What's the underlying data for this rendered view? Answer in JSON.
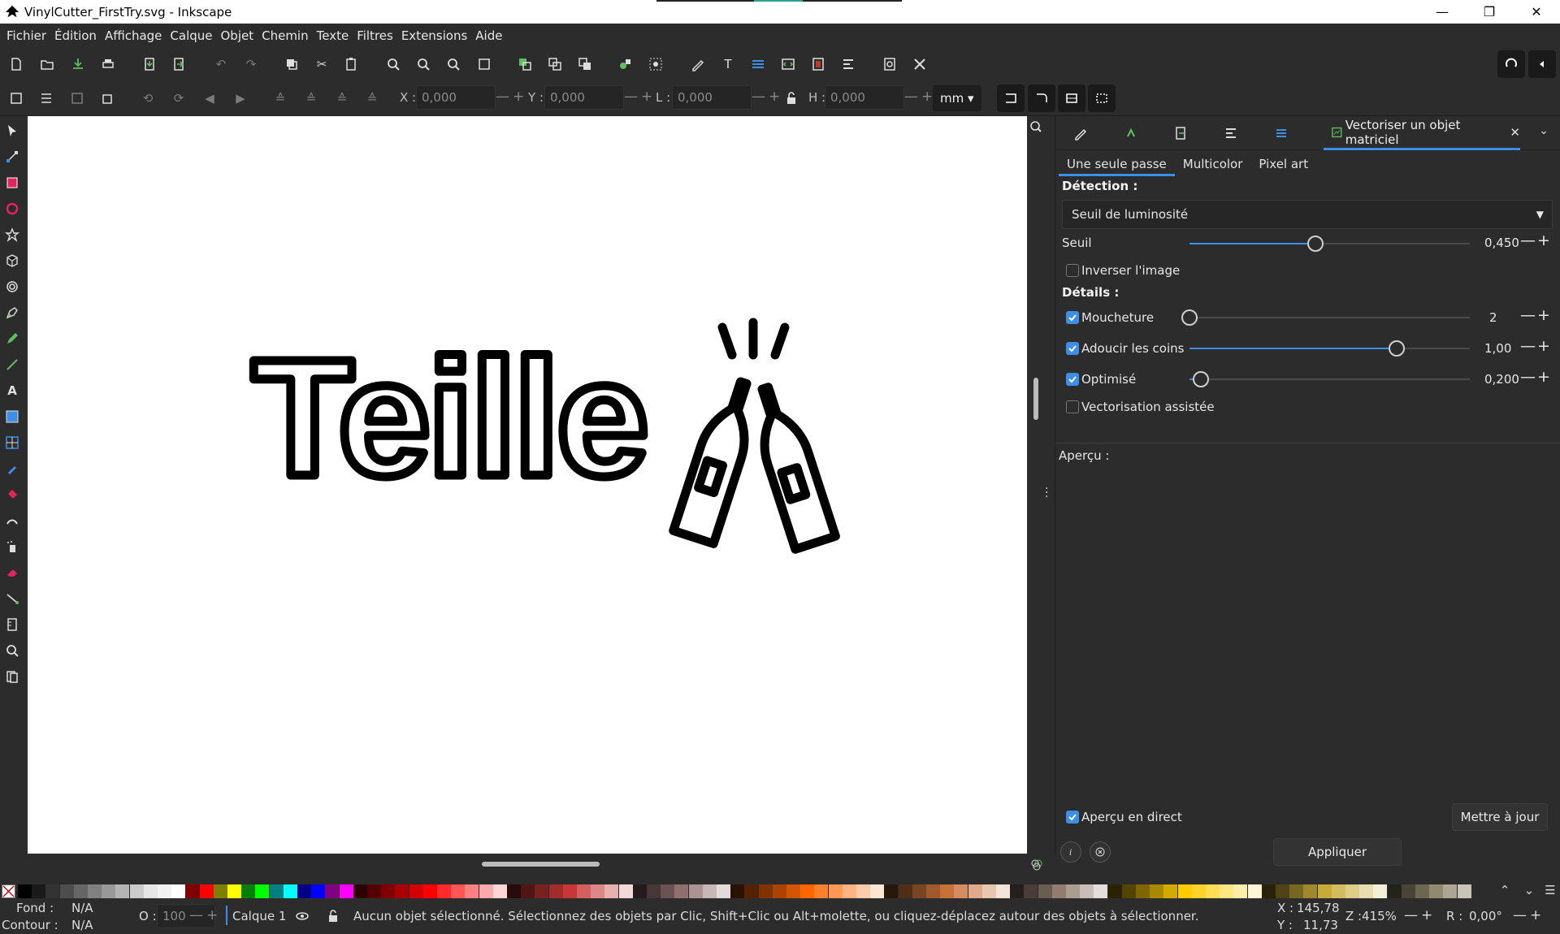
{
  "window": {
    "title": "VinylCutter_FirstTry.svg - Inkscape"
  },
  "menu": [
    "Fichier",
    "Édition",
    "Affichage",
    "Calque",
    "Objet",
    "Chemin",
    "Texte",
    "Filtres",
    "Extensions",
    "Aide"
  ],
  "toolctrl": {
    "x_label": "X :",
    "x_value": "0,000",
    "y_label": "Y :",
    "y_value": "0,000",
    "w_label": "L :",
    "w_value": "0,000",
    "h_label": "H :",
    "h_value": "0,000",
    "unit": "mm"
  },
  "canvas": {
    "text": "Teille",
    "zoom_text": "415%"
  },
  "panel": {
    "active_tab": "Vectoriser un objet matriciel",
    "subtabs": [
      "Une seule passe",
      "Multicolor",
      "Pixel art"
    ],
    "detection_title": "Détection :",
    "detection_mode": "Seuil de luminosité",
    "threshold_label": "Seuil",
    "threshold_value": "0,450",
    "threshold_fraction": 0.45,
    "invert_label": "Inverser l'image",
    "invert_checked": false,
    "details_title": "Détails :",
    "speckles_label": "Moucheture",
    "speckles_checked": true,
    "speckles_value": "2",
    "speckles_fraction": 0.0,
    "smooth_label": "Adoucir les coins",
    "smooth_checked": true,
    "smooth_value": "1,00",
    "smooth_fraction": 0.74,
    "optimize_label": "Optimisé",
    "optimize_checked": true,
    "optimize_value": "0,200",
    "optimize_fraction": 0.04,
    "assisted_label": "Vectorisation assistée",
    "assisted_checked": false,
    "preview_label": "Aperçu :",
    "live_preview_label": "Aperçu en direct",
    "live_preview_checked": true,
    "update_label": "Mettre à jour",
    "apply_label": "Appliquer"
  },
  "palette": {
    "colors": [
      "#000000",
      "#1a1a1a",
      "#333333",
      "#4d4d4d",
      "#666666",
      "#808080",
      "#999999",
      "#b3b3b3",
      "#cccccc",
      "#e6e6e6",
      "#f2f2f2",
      "#ffffff",
      "#800000",
      "#ff0000",
      "#808000",
      "#ffff00",
      "#008000",
      "#00ff00",
      "#008080",
      "#00ffff",
      "#000080",
      "#0000ff",
      "#800080",
      "#ff00ff",
      "#2b0000",
      "#550000",
      "#800000",
      "#aa0000",
      "#d40000",
      "#ff0000",
      "#ff2a2a",
      "#ff5555",
      "#ff8080",
      "#ffaaaa",
      "#ffd5d5",
      "#280b0b",
      "#501616",
      "#782121",
      "#a02c2c",
      "#c83737",
      "#d35f5f",
      "#de8787",
      "#e9afaf",
      "#f4d7d7",
      "#241c1c",
      "#483737",
      "#6c5353",
      "#916f6f",
      "#ac9393",
      "#c8b7b7",
      "#e3dbdb",
      "#2b1100",
      "#552200",
      "#803300",
      "#aa4400",
      "#d45500",
      "#ff6600",
      "#ff7f2a",
      "#ff9955",
      "#ffb380",
      "#ffccaa",
      "#ffe6d5",
      "#28170b",
      "#502d16",
      "#784421",
      "#a05a2c",
      "#c87137",
      "#d38d5f",
      "#deaa87",
      "#e9c6af",
      "#f4e3d7",
      "#241f1c",
      "#483e37",
      "#6c5d53",
      "#917c6f",
      "#ac9d93",
      "#c8beb7",
      "#e3dedb",
      "#2b2200",
      "#554400",
      "#806600",
      "#aa8800",
      "#d4aa00",
      "#ffcc00",
      "#ffd42a",
      "#ffdd55",
      "#ffe680",
      "#ffeeaa",
      "#fff6d5",
      "#28220b",
      "#504416",
      "#786721",
      "#a0892c",
      "#c8ab37",
      "#d3bc5f",
      "#decd87",
      "#e9ddaf",
      "#f4eed7",
      "#24221c",
      "#484537",
      "#6c6753",
      "#918a6f",
      "#aca793",
      "#c8c4b7"
    ]
  },
  "status": {
    "fill_label": "Fond :",
    "fill_value": "N/A",
    "stroke_label": "Contour :",
    "stroke_value": "N/A",
    "opacity_label": "O :",
    "opacity_value": "100",
    "layer": "Calque 1",
    "message": "Aucun objet sélectionné. Sélectionnez des objets par Clic, Shift+Clic ou Alt+molette, ou cliquez-déplacez autour des objets à sélectionner.",
    "x_label": "X :",
    "x_value": "145,78",
    "y_label": "Y :",
    "y_value": "11,73",
    "zoom_label": "Z :",
    "zoom_value": "415%",
    "rotate_label": "R :",
    "rotate_value": "0,00°"
  }
}
